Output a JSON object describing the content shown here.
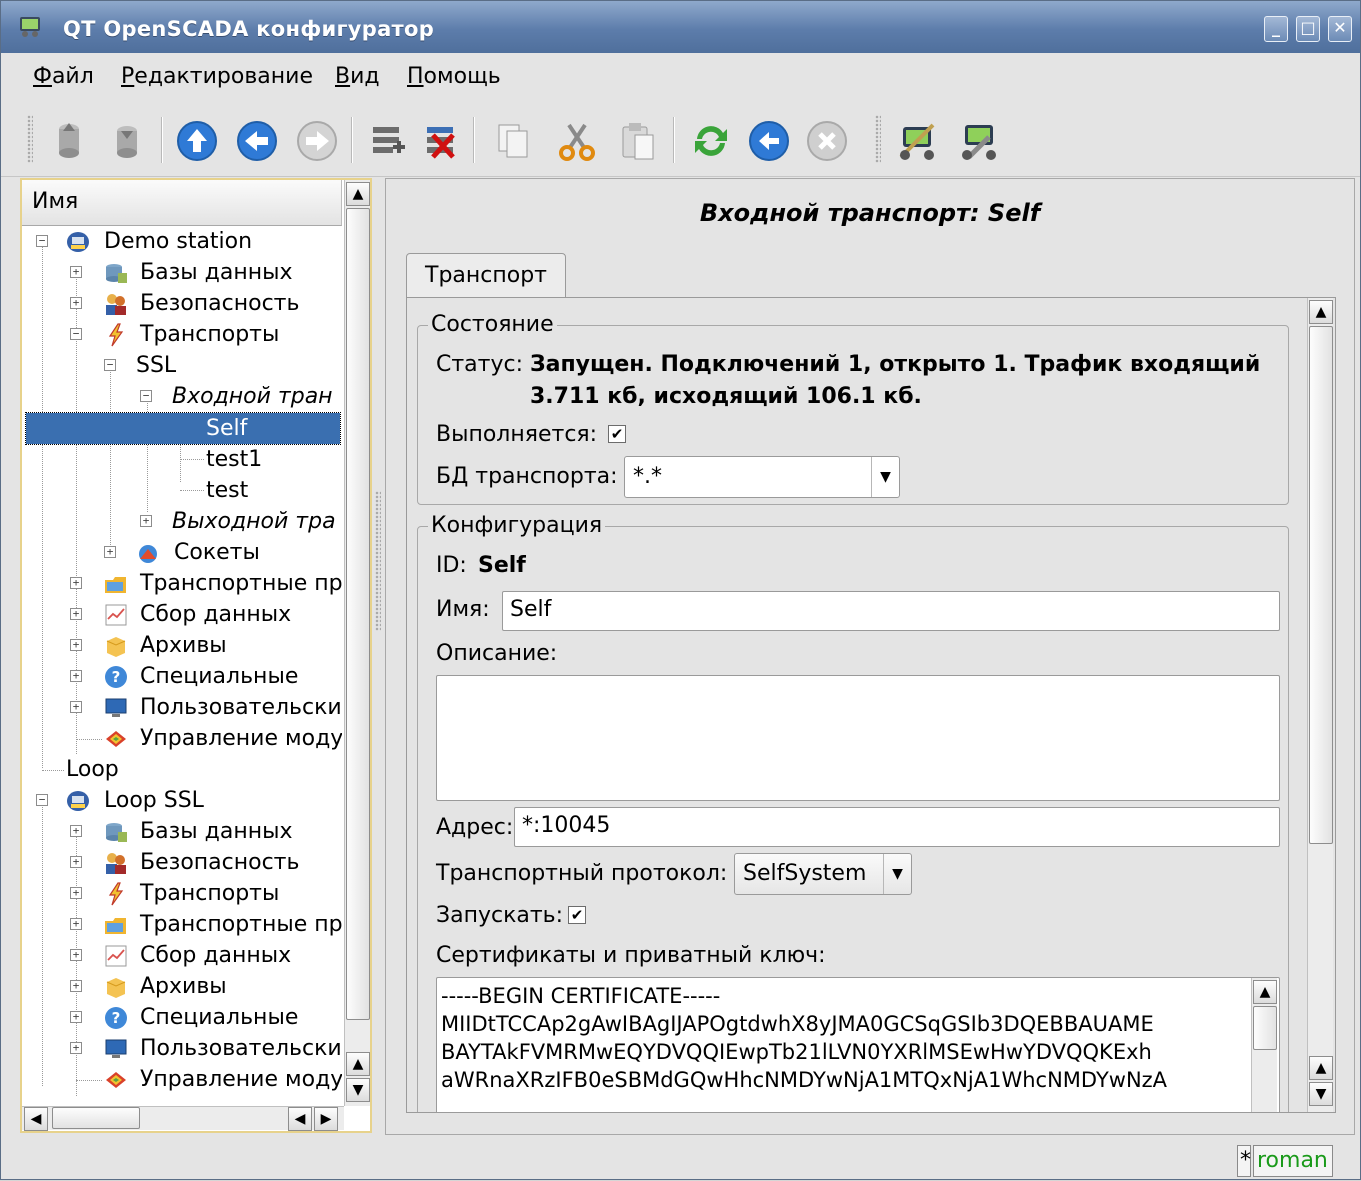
{
  "window": {
    "title": "QT OpenSCADA конфигуратор"
  },
  "menu": [
    {
      "underline": "Ф",
      "rest": "айл"
    },
    {
      "underline": "Р",
      "rest": "едактирование"
    },
    {
      "underline": "В",
      "rest": "ид"
    },
    {
      "underline": "П",
      "rest": "омощь"
    }
  ],
  "toolbar": {
    "icons": [
      "load-icon",
      "save-icon",
      "up-icon",
      "back-icon",
      "forward-icon",
      "add-item-icon",
      "delete-item-icon",
      "copy-icon",
      "cut-icon",
      "paste-icon",
      "refresh-icon",
      "start-icon",
      "stop-icon",
      "configurator-icon",
      "config-tool-icon"
    ]
  },
  "tree": {
    "header": "Имя",
    "nodes": [
      {
        "label": "Demo station"
      },
      {
        "label": "Базы данных"
      },
      {
        "label": "Безопасность"
      },
      {
        "label": "Транспорты"
      },
      {
        "label": "SSL"
      },
      {
        "label": "Входной тран"
      },
      {
        "label": "Self"
      },
      {
        "label": "test1"
      },
      {
        "label": "test"
      },
      {
        "label": "Выходной тра"
      },
      {
        "label": "Сокеты"
      },
      {
        "label": "Транспортные пр"
      },
      {
        "label": "Сбор данных"
      },
      {
        "label": "Архивы"
      },
      {
        "label": "Специальные"
      },
      {
        "label": "Пользовательские"
      },
      {
        "label": "Управление моду"
      },
      {
        "label": "Loop"
      },
      {
        "label": "Loop SSL"
      },
      {
        "label": "Базы данных"
      },
      {
        "label": "Безопасность"
      },
      {
        "label": "Транспорты"
      },
      {
        "label": "Транспортные пр"
      },
      {
        "label": "Сбор данных"
      },
      {
        "label": "Архивы"
      },
      {
        "label": "Специальные"
      },
      {
        "label": "Пользовательские"
      },
      {
        "label": "Управление моду"
      }
    ]
  },
  "page": {
    "title": "Входной транспорт: Self",
    "tab": "Транспорт",
    "state": {
      "legend": "Состояние",
      "status_label": "Статус:",
      "status_line1": "Запущен. Подключений 1, открыто 1. Трафик входящий",
      "status_line2": "3.711 кб, исходящий 106.1 кб.",
      "running_label": "Выполняется:",
      "running_checked": true,
      "db_label": "БД транспорта:",
      "db_value": "*.*"
    },
    "config": {
      "legend": "Конфигурация",
      "id_label": "ID:",
      "id_value": "Self",
      "name_label": "Имя:",
      "name_value": "Self",
      "descr_label": "Описание:",
      "descr_value": "",
      "addr_label": "Адрес:",
      "addr_value": "*:10045",
      "proto_label": "Транспортный протокол:",
      "proto_value": "SelfSystem",
      "start_label": "Запускать:",
      "start_checked": true,
      "cert_label": "Сертификаты и приватный ключ:",
      "cert_lines": [
        "-----BEGIN CERTIFICATE-----",
        "MIIDtTCCAp2gAwIBAgIJAPOgtdwhX8yJMA0GCSqGSIb3DQEBBAUAME",
        "BAYTAkFVMRMwEQYDVQQIEwpTb21lLVN0YXRlMSEwHwYDVQQKExh",
        "aWRnaXRzIFB0eSBMdGQwHhcNMDYwNjA1MTQxNjA1WhcNMDYwNzA"
      ]
    }
  },
  "statusbar": {
    "modified": "*",
    "user": "roman"
  },
  "colors": {
    "selection": "#3a6fb0",
    "titlebar": "#5d7dab",
    "user": "#1a9a1a"
  }
}
